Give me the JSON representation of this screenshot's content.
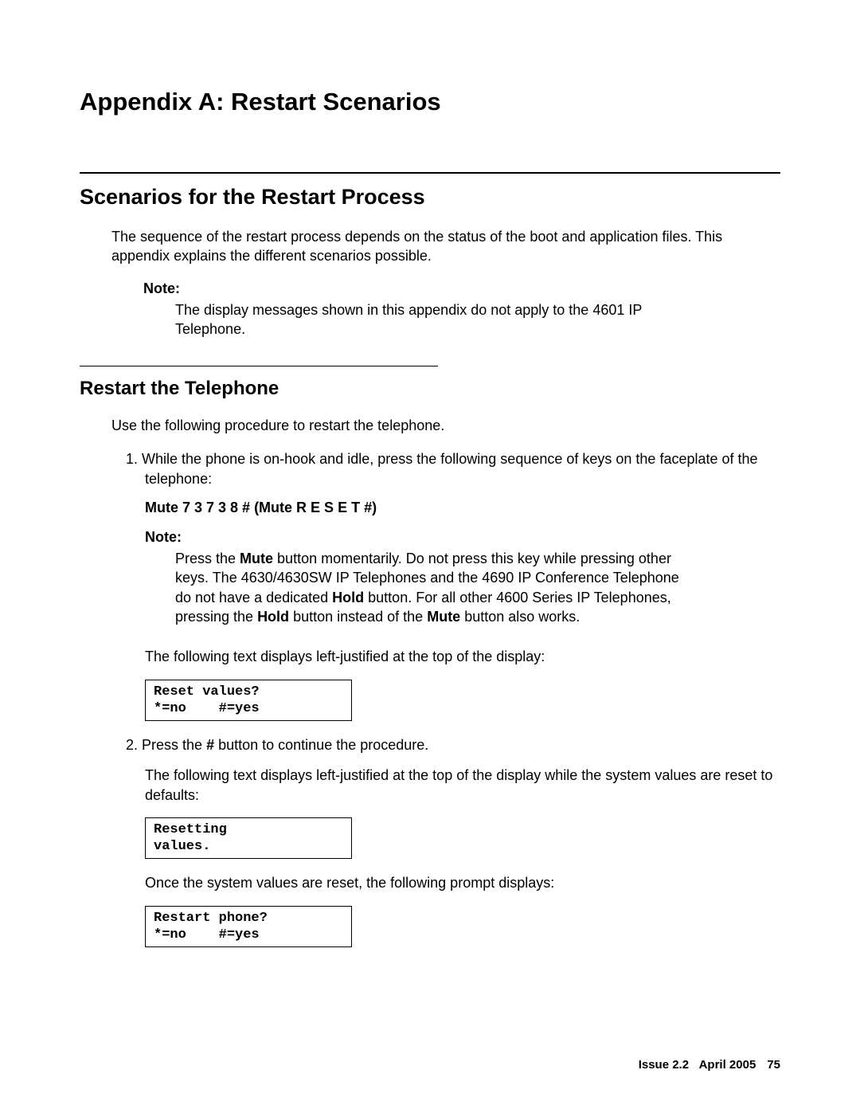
{
  "title": "Appendix A: Restart Scenarios",
  "section1": {
    "heading": "Scenarios for the Restart Process",
    "intro": "The sequence of the restart process depends on the status of the boot and application files. This appendix explains the different scenarios possible.",
    "note_label": "Note:",
    "note_body": "The display messages shown in this appendix do not apply to the 4601 IP Telephone."
  },
  "section2": {
    "heading": "Restart the Telephone",
    "intro": "Use the following procedure to restart the telephone.",
    "step1_num": "1.",
    "step1_text": "While the phone is on-hook and idle, press the following sequence of keys on the faceplate of the telephone:",
    "mute_seq": "Mute 7 3 7 3 8 # (Mute R E S E T #)",
    "note_label": "Note:",
    "note_body_pre": "Press the ",
    "note_bold1": "Mute",
    "note_body_mid1": " button momentarily. Do not press this key while pressing other keys. The 4630/4630SW IP Telephones and the 4690 IP Conference Telephone do not have a dedicated ",
    "note_bold2": "Hold",
    "note_body_mid2": " button. For all other 4600 Series IP Telephones, pressing the ",
    "note_bold3": "Hold",
    "note_body_mid3": " button instead of the ",
    "note_bold4": "Mute",
    "note_body_end": " button also works.",
    "step1_after": "The following text displays left-justified at the top of the display:",
    "display1": "Reset values?\n*=no    #=yes",
    "step2_num": "2.",
    "step2_pre": "Press the ",
    "step2_hash": "#",
    "step2_post": " button to continue the procedure.",
    "step2_after": "The following text displays left-justified at the top of the display while the system values are reset to defaults:",
    "display2": "Resetting\nvalues.",
    "step2_final": "Once the system values are reset, the following prompt displays:",
    "display3": "Restart phone?\n*=no    #=yes"
  },
  "footer": {
    "issue": "Issue 2.2",
    "date": "April 2005",
    "page": "75"
  }
}
